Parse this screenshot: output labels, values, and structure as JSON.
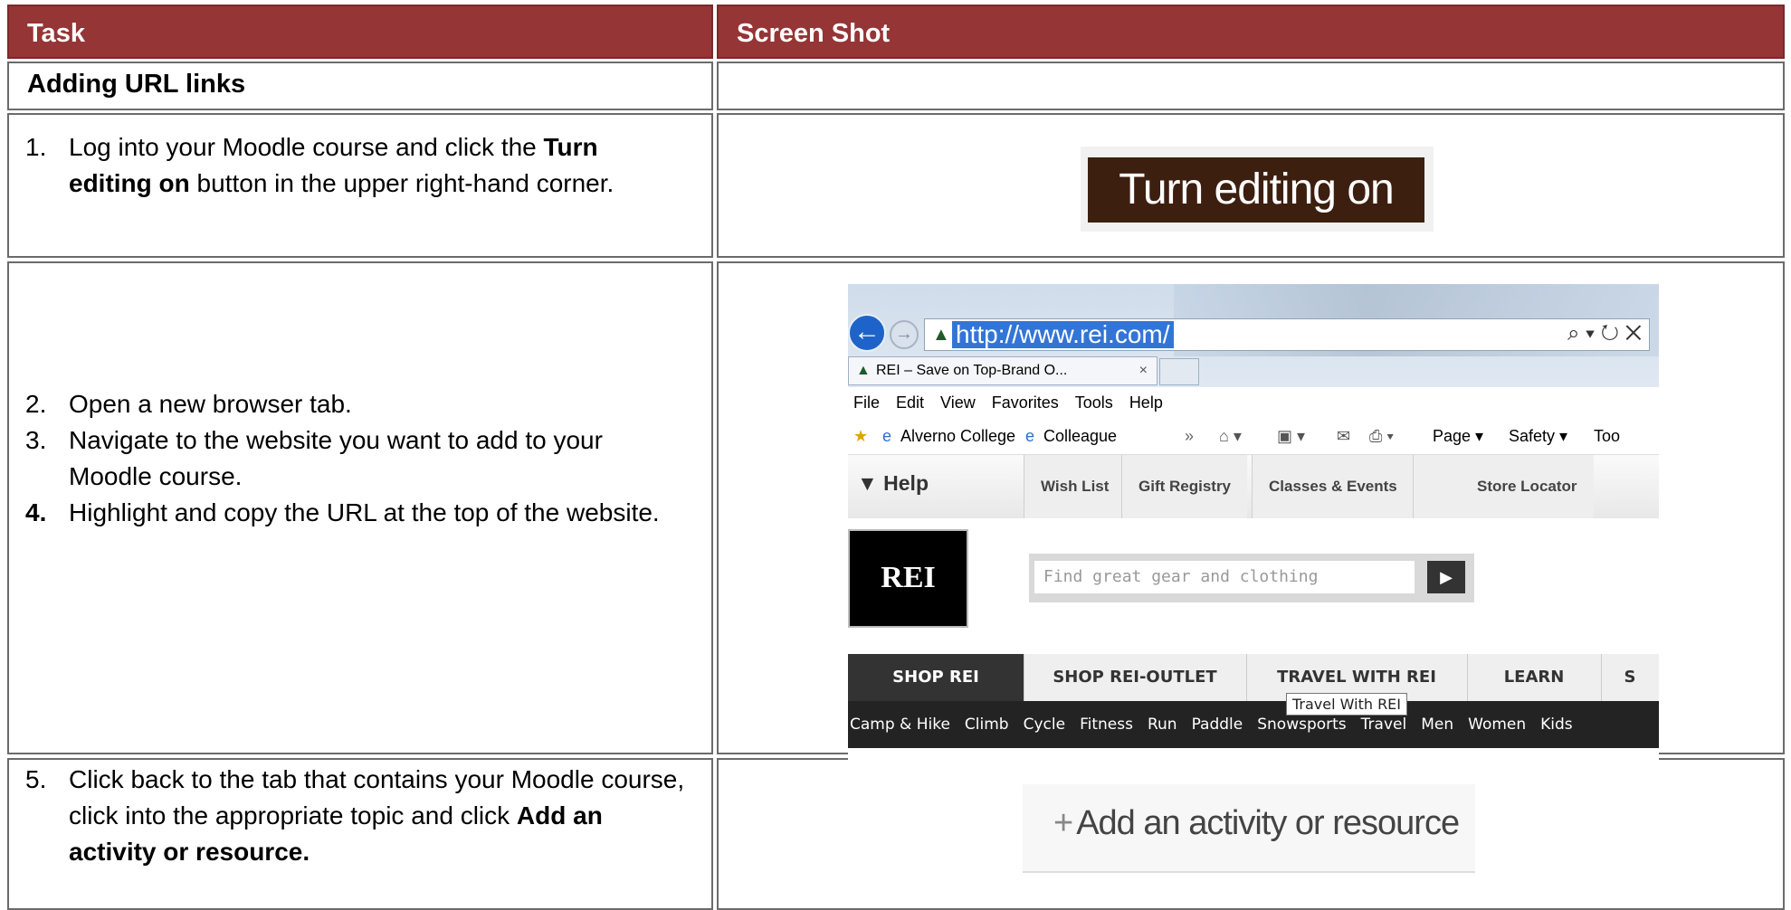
{
  "header": {
    "task": "Task",
    "screenshot": "Screen Shot"
  },
  "section": {
    "title": "Adding URL links"
  },
  "rows": [
    {
      "steps": [
        {
          "num": "1.",
          "text_a": "Log into your Moodle course and click the ",
          "bold": "Turn editing on",
          "text_b": " button in the upper right-hand corner."
        }
      ]
    },
    {
      "steps": [
        {
          "num": "2.",
          "text": "Open a new browser tab."
        },
        {
          "num": "3.",
          "text": "Navigate to the website you want to add to your Moodle course."
        },
        {
          "num": "4.",
          "text": "Highlight and copy the URL at the top of the website."
        }
      ]
    },
    {
      "steps": [
        {
          "num": "5.",
          "text_a": "Click back to the tab that contains your Moodle course, click into the appropriate topic and click ",
          "bold": "Add an activity or resource."
        }
      ]
    }
  ],
  "screens": {
    "turn_editing": "Turn editing on",
    "add_activity": {
      "plus": "+",
      "label": "Add an activity or resource"
    },
    "browser": {
      "url": "http://www.rei.com/",
      "tools": "⌕ ▾ ↻ ✕",
      "tab_title": "REI – Save on Top-Brand O...",
      "tab_close": "×",
      "menu": [
        "File",
        "Edit",
        "View",
        "Favorites",
        "Tools",
        "Help"
      ],
      "favorites": [
        "Alverno College",
        "Colleague"
      ],
      "fav_tools": [
        "Page ▾",
        "Safety ▾",
        "Too"
      ],
      "help": "▼ Help",
      "nav": [
        "Wish List",
        "Gift Registry",
        "Classes & Events",
        "Store Locator"
      ],
      "logo": "REI",
      "search_placeholder": "Find great gear and clothing",
      "search_go": "▶",
      "shop_tabs": [
        "SHOP REI",
        "SHOP REI-OUTLET",
        "TRAVEL WITH REI",
        "LEARN",
        "S"
      ],
      "tooltip": "Travel With REI",
      "categories": [
        "Camp & Hike",
        "Climb",
        "Cycle",
        "Fitness",
        "Run",
        "Paddle",
        "Snowsports",
        "Travel",
        "Men",
        "Women",
        "Kids"
      ]
    }
  }
}
